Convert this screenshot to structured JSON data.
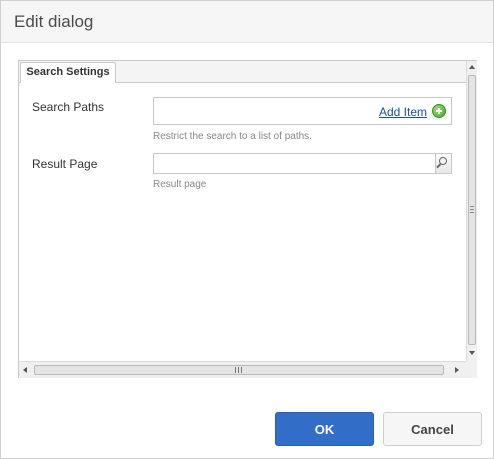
{
  "dialog": {
    "title": "Edit dialog"
  },
  "tabs": [
    {
      "label": "Search Settings",
      "active": true
    }
  ],
  "form": {
    "search_paths": {
      "label": "Search Paths",
      "add_item": "Add Item",
      "hint": "Restrict the search to a list of paths.",
      "value": ""
    },
    "result_page": {
      "label": "Result Page",
      "hint": "Result page",
      "value": ""
    }
  },
  "footer": {
    "ok_label": "OK",
    "cancel_label": "Cancel"
  },
  "colors": {
    "primary": "#326ec8",
    "link": "#1b4fa0"
  },
  "icons": [
    "plus-circle-icon",
    "search-icon"
  ]
}
